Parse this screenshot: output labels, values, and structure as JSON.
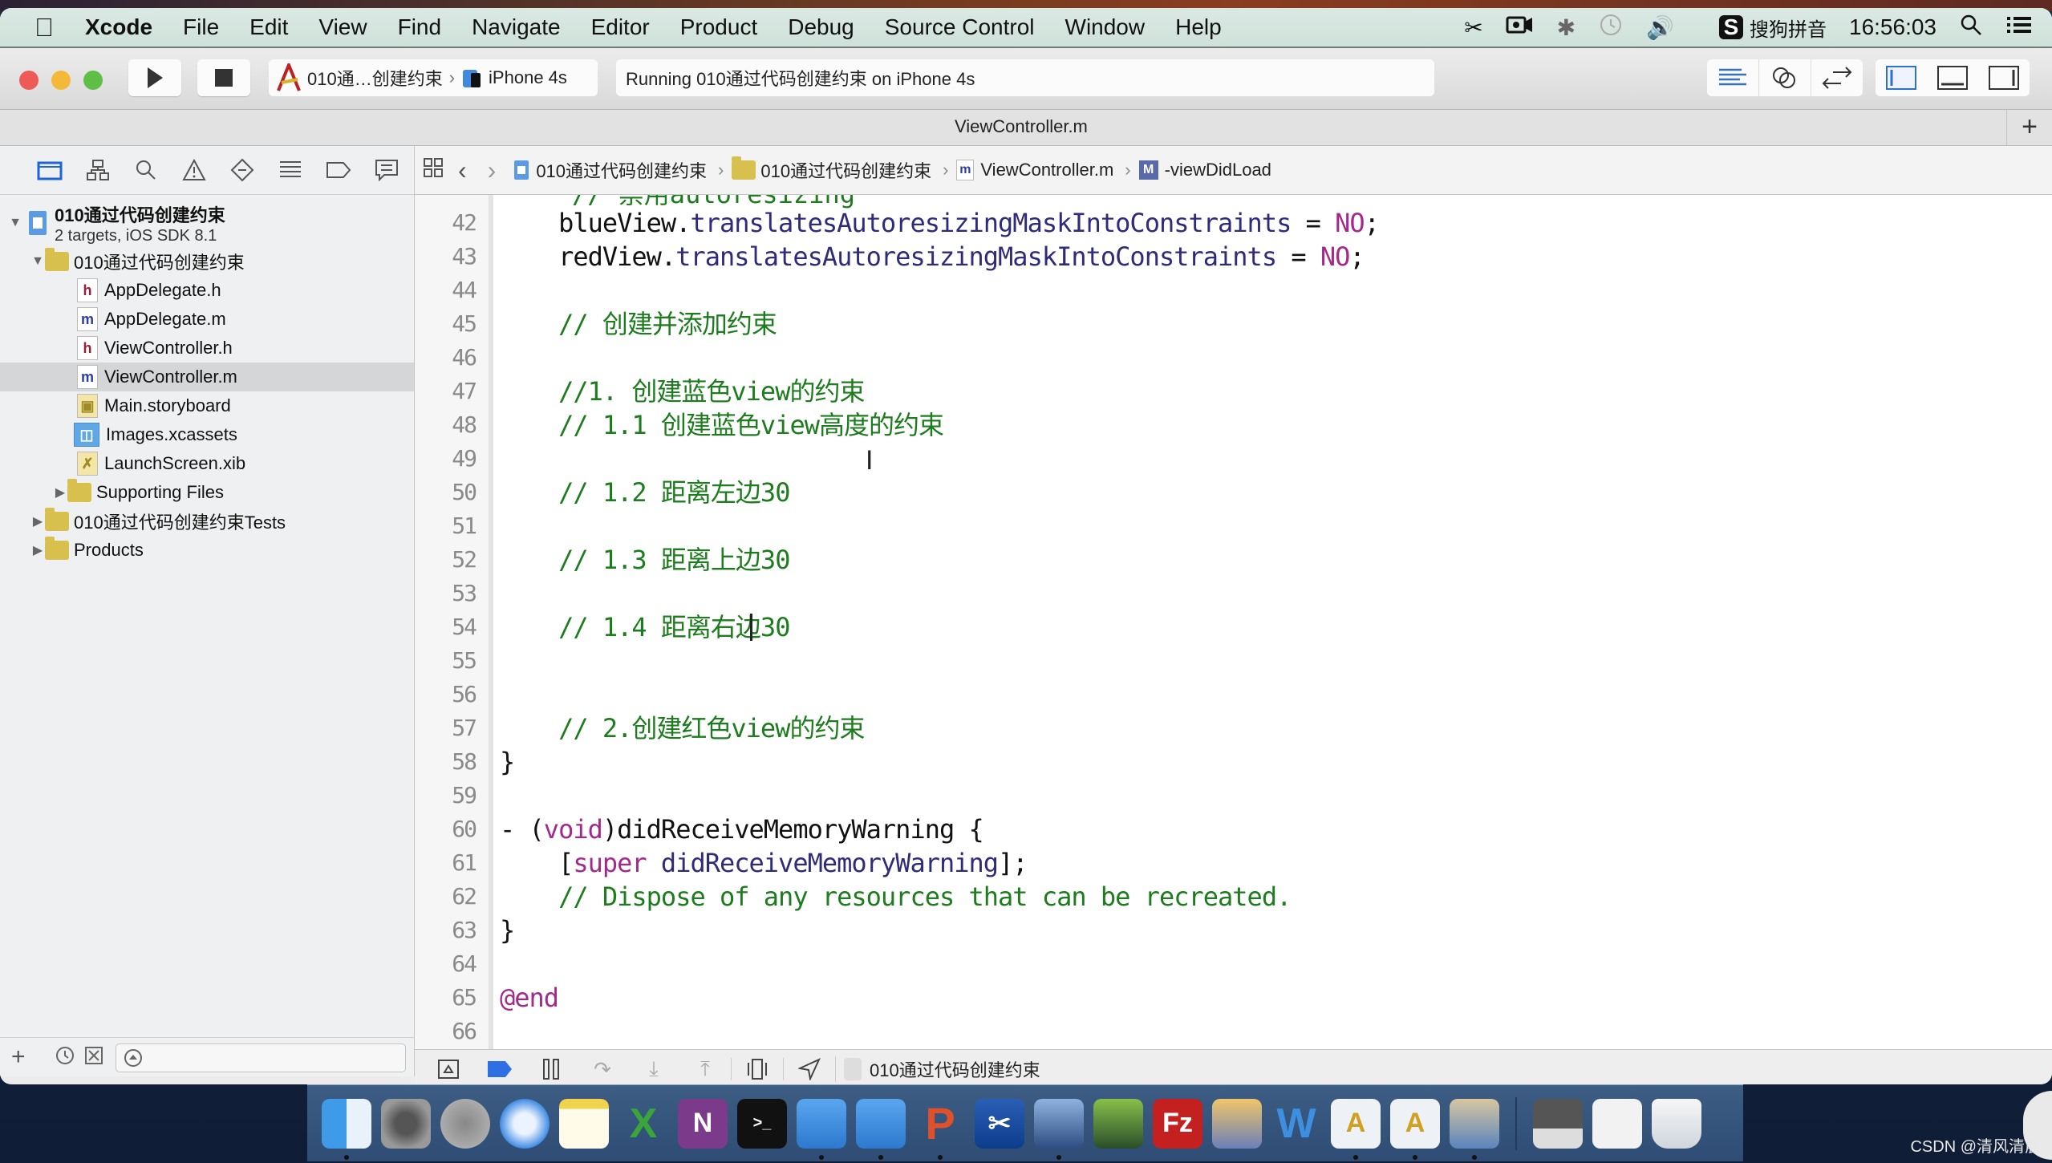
{
  "menubar": {
    "apple_icon": "apple-logo",
    "app_name": "Xcode",
    "items": [
      "File",
      "Edit",
      "View",
      "Find",
      "Navigate",
      "Editor",
      "Product",
      "Debug",
      "Source Control",
      "Window",
      "Help"
    ],
    "status_icons": [
      "scissors-icon",
      "video-camera-icon",
      "bluetooth-icon",
      "time-machine-icon",
      "volume-icon"
    ],
    "input_method_badge": "S",
    "input_method": "搜狗拼音",
    "clock": "16:56:03",
    "spotlight_icon": "search-icon",
    "notification_icon": "list-icon"
  },
  "toolbar": {
    "run_icon": "play-icon",
    "stop_icon": "stop-icon",
    "scheme_name": "010通…创建约束",
    "device_name": "iPhone 4s",
    "activity_status": "Running 010通过代码创建约束 on iPhone 4s",
    "editor_modes": [
      "standard-editor",
      "assistant-editor",
      "version-editor"
    ],
    "view_toggles": [
      "navigator",
      "debug-area",
      "utilities"
    ]
  },
  "tabbar": {
    "title": "ViewController.m",
    "add_tab": "+"
  },
  "navigator": {
    "tabs": [
      "project",
      "symbol",
      "find",
      "issue",
      "test",
      "debug",
      "breakpoint",
      "report"
    ],
    "project": {
      "name": "010通过代码创建约束",
      "subtitle": "2 targets, iOS SDK 8.1"
    },
    "tree": [
      {
        "label": "010通过代码创建约束",
        "type": "folder",
        "expanded": true
      },
      {
        "label": "AppDelegate.h",
        "type": "h"
      },
      {
        "label": "AppDelegate.m",
        "type": "m"
      },
      {
        "label": "ViewController.h",
        "type": "h"
      },
      {
        "label": "ViewController.m",
        "type": "m",
        "selected": true
      },
      {
        "label": "Main.storyboard",
        "type": "storyboard"
      },
      {
        "label": "Images.xcassets",
        "type": "xcassets"
      },
      {
        "label": "LaunchScreen.xib",
        "type": "xib"
      },
      {
        "label": "Supporting Files",
        "type": "folder",
        "expanded": false
      },
      {
        "label": "010通过代码创建约束Tests",
        "type": "folder",
        "expanded": false
      },
      {
        "label": "Products",
        "type": "folder",
        "expanded": false
      }
    ],
    "filter_placeholder": ""
  },
  "jumpbar": {
    "crumbs": [
      "010通过代码创建约束",
      "010通过代码创建约束",
      "ViewController.m",
      "-viewDidLoad"
    ]
  },
  "editor": {
    "cursor_line": 54,
    "lines": [
      {
        "n": "42",
        "segments": [
          {
            "t": "    blueView.",
            "c": ""
          },
          {
            "t": "translatesAutoresizingMaskIntoConstraints",
            "c": "meth"
          },
          {
            "t": " = ",
            "c": ""
          },
          {
            "t": "NO",
            "c": "kw"
          },
          {
            "t": ";",
            "c": ""
          }
        ]
      },
      {
        "n": "43",
        "segments": [
          {
            "t": "    redView.",
            "c": ""
          },
          {
            "t": "translatesAutoresizingMaskIntoConstraints",
            "c": "meth"
          },
          {
            "t": " = ",
            "c": ""
          },
          {
            "t": "NO",
            "c": "kw"
          },
          {
            "t": ";",
            "c": ""
          }
        ]
      },
      {
        "n": "44",
        "segments": []
      },
      {
        "n": "45",
        "segments": [
          {
            "t": "    // 创建并添加约束",
            "c": "com"
          }
        ]
      },
      {
        "n": "46",
        "segments": []
      },
      {
        "n": "47",
        "segments": [
          {
            "t": "    //1. 创建蓝色view的约束",
            "c": "com"
          }
        ]
      },
      {
        "n": "48",
        "segments": [
          {
            "t": "    // 1.1 创建蓝色view高度的约束",
            "c": "com"
          }
        ]
      },
      {
        "n": "49",
        "segments": []
      },
      {
        "n": "50",
        "segments": [
          {
            "t": "    // 1.2 距离左边30",
            "c": "com"
          }
        ]
      },
      {
        "n": "51",
        "segments": []
      },
      {
        "n": "52",
        "segments": [
          {
            "t": "    // 1.3 距离上边30",
            "c": "com"
          }
        ]
      },
      {
        "n": "53",
        "segments": []
      },
      {
        "n": "54",
        "segments": [
          {
            "t": "    // 1.4 距离右边30",
            "c": "com"
          }
        ]
      },
      {
        "n": "55",
        "segments": []
      },
      {
        "n": "56",
        "segments": []
      },
      {
        "n": "57",
        "segments": [
          {
            "t": "    // 2.创建红色view的约束",
            "c": "com"
          }
        ]
      },
      {
        "n": "58",
        "segments": [
          {
            "t": "}",
            "c": ""
          }
        ]
      },
      {
        "n": "59",
        "segments": []
      },
      {
        "n": "60",
        "segments": [
          {
            "t": "- (",
            "c": ""
          },
          {
            "t": "void",
            "c": "kw"
          },
          {
            "t": ")didReceiveMemoryWarning {",
            "c": ""
          }
        ]
      },
      {
        "n": "61",
        "segments": [
          {
            "t": "    [",
            "c": ""
          },
          {
            "t": "super",
            "c": "kw"
          },
          {
            "t": " ",
            "c": ""
          },
          {
            "t": "didReceiveMemoryWarning",
            "c": "meth"
          },
          {
            "t": "];",
            "c": ""
          }
        ]
      },
      {
        "n": "62",
        "segments": [
          {
            "t": "    // Dispose of any resources that can be recreated.",
            "c": "com"
          }
        ]
      },
      {
        "n": "63",
        "segments": [
          {
            "t": "}",
            "c": ""
          }
        ]
      },
      {
        "n": "64",
        "segments": []
      },
      {
        "n": "65",
        "segments": [
          {
            "t": "@end",
            "c": "kw"
          }
        ]
      },
      {
        "n": "66",
        "segments": []
      }
    ]
  },
  "debugbar": {
    "icons": [
      "hide-debug-area",
      "breakpoints-toggle",
      "pause",
      "step-over",
      "step-into",
      "step-out",
      "view-debugger",
      "simulate-location"
    ],
    "process_label": "010通过代码创建约束"
  },
  "nav_bottom": {
    "add": "+"
  },
  "dock": {
    "apps": [
      {
        "name": "Finder",
        "running": true
      },
      {
        "name": "System Preferences",
        "running": false
      },
      {
        "name": "Launchpad",
        "running": false
      },
      {
        "name": "Safari",
        "running": false
      },
      {
        "name": "Notes",
        "running": false
      },
      {
        "name": "Excel",
        "running": false
      },
      {
        "name": "OneNote",
        "running": false
      },
      {
        "name": "Terminal",
        "running": false
      },
      {
        "name": "Xcode",
        "running": true
      },
      {
        "name": "Simulator",
        "running": true
      },
      {
        "name": "PowerPoint",
        "running": true
      },
      {
        "name": "Screenshot",
        "running": false
      },
      {
        "name": "Video Editor",
        "running": true
      },
      {
        "name": "FTP Client",
        "running": false
      },
      {
        "name": "FileZilla",
        "running": false
      },
      {
        "name": "Pages",
        "running": false
      },
      {
        "name": "Word",
        "running": false
      },
      {
        "name": "Document A",
        "running": true
      },
      {
        "name": "Document B",
        "running": true
      },
      {
        "name": "Preview",
        "running": true
      },
      {
        "name": "Screen Window 1",
        "running": false
      },
      {
        "name": "Screen Window 2",
        "running": false
      },
      {
        "name": "Trash",
        "running": false
      }
    ],
    "watermark": "CSDN @清风清晨"
  },
  "colors": {
    "comment": "#1d7c1d",
    "keyword": "#a32a8c",
    "method": "#2f2b7a",
    "selection": "#d4d6d8",
    "accent": "#1f63d9"
  }
}
